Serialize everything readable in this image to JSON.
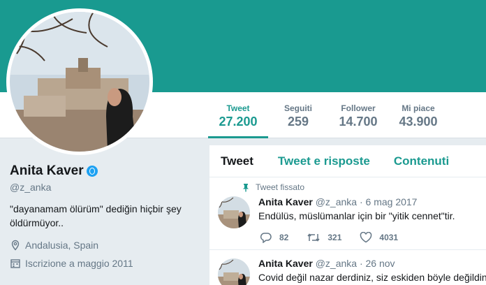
{
  "stats": [
    {
      "label": "Tweet",
      "value": "27.200"
    },
    {
      "label": "Seguiti",
      "value": "259"
    },
    {
      "label": "Follower",
      "value": "14.700"
    },
    {
      "label": "Mi piace",
      "value": "43.900"
    }
  ],
  "profile": {
    "name": "Anita Kaver",
    "handle": "@z_anka",
    "bio_line1": "\"dayanamam ölürüm\" dediğin hiçbir şey",
    "bio_line2": "öldürmüyor..",
    "location": "Andalusia, Spain",
    "joined": "Iscrizione a maggio 2011"
  },
  "tabs": [
    "Tweet",
    "Tweet e risposte",
    "Contenuti"
  ],
  "tweets": [
    {
      "pinned_label": "Tweet fissato",
      "name": "Anita Kaver",
      "handle": "@z_anka",
      "sep": "·",
      "date": "6 mag 2017",
      "text": "Endülüs, müslümanlar için bir \"yitik cennet\"tir.",
      "replies": "82",
      "retweets": "321",
      "likes": "4031"
    },
    {
      "name": "Anita Kaver",
      "handle": "@z_anka",
      "sep": "·",
      "date": "26 nov",
      "text": "Covid değil nazar derdiniz, siz eskiden böyle değildin"
    }
  ],
  "colors": {
    "banner": "#199a90",
    "accent": "#1b9a90",
    "muted": "#657786",
    "background": "#e6ecf0"
  },
  "icons": [
    "verified-globe-icon",
    "location-pin-icon",
    "calendar-icon",
    "pin-icon",
    "reply-icon",
    "retweet-icon",
    "like-icon"
  ]
}
